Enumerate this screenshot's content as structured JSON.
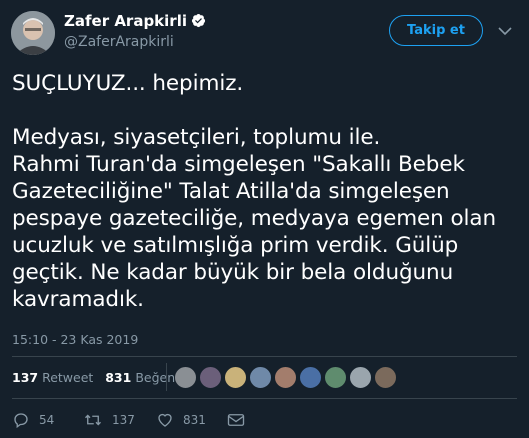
{
  "author": {
    "name": "Zafer Arapkirli",
    "handle": "@ZaferArapkirli",
    "verified": true,
    "avatar": "avatar-icon"
  },
  "header": {
    "follow_label": "Takip et",
    "menu_icon": "chevron-down-icon"
  },
  "tweet": {
    "lines": [
      "SUÇLUYUZ... hepimiz.",
      "",
      "Medyası, siyasetçileri, toplumu ile.",
      "Rahmi Turan'da simgeleşen \"Sakallı Bebek",
      "Gazeteciliğine\" Talat Atilla'da simgeleşen",
      "pespaye gazeteciliğe, medyaya egemen olan",
      "ucuzluk ve satılmışlığa prim verdik. Gülüp",
      "geçtik. Ne kadar büyük bir bela olduğunu",
      "kavramadık."
    ],
    "timestamp": "15:10 - 23 Kas 2019"
  },
  "stats": {
    "retweets": "137",
    "retweets_label": "Retweet",
    "likes": "831",
    "likes_label": "Beğeni",
    "liker_colors": [
      "#8a8f94",
      "#6b5f7a",
      "#c9b27a",
      "#6f89a8",
      "#a37d6c",
      "#4a6fa5",
      "#5f8c6e",
      "#9aa5ad",
      "#7b6a5c"
    ]
  },
  "actions": {
    "replies": "54",
    "retweets": "137",
    "likes": "831"
  },
  "colors": {
    "background": "#15202b",
    "accent": "#1da1f2",
    "muted": "#8899a6",
    "divider": "#38444d"
  }
}
